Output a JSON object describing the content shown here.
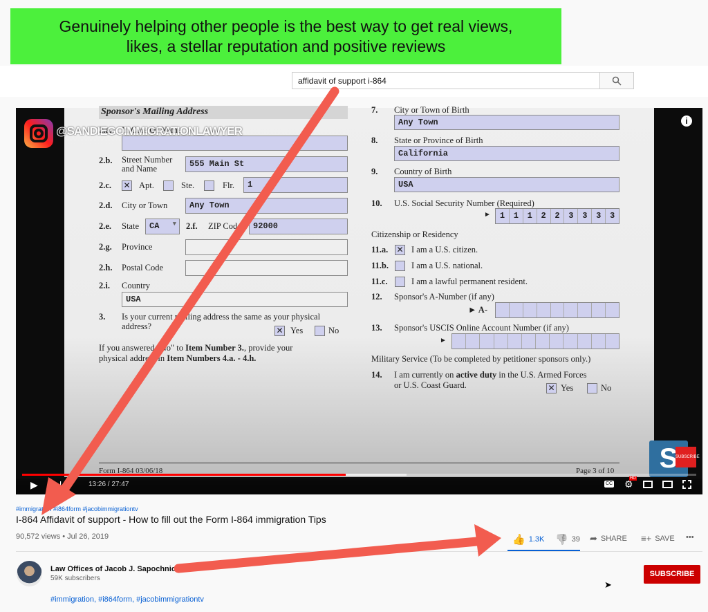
{
  "banner": {
    "line1": "Genuinely helping other people is the best way to get real views,",
    "line2": "likes, a stellar reputation and positive reviews",
    "color": "#4cf03c"
  },
  "search": {
    "value": "affidavit of support i-864",
    "icon": "search-icon"
  },
  "video": {
    "watermark": "@SANDIEGOIMMIGRATIONLAWYER",
    "time": "13:26 / 27:47",
    "progress": 0.48,
    "buffered": 0.57,
    "left": {
      "header": "Sponsor's Mailing Address",
      "a_num": "2.a.",
      "a_label": "In Care Of Name",
      "b_num": "2.b.",
      "b_label1": "Street Number",
      "b_label2": "and Name",
      "b_value": "555 Main St",
      "c_num": "2.c.",
      "c_apt": "Apt.",
      "c_ste": "Ste.",
      "c_flr": "Flr.",
      "c_value": "1",
      "c_mark": "✕",
      "d_num": "2.d.",
      "d_label": "City or Town",
      "d_value": "Any Town",
      "e_num": "2.e.",
      "e_label": "State",
      "e_value": "CA",
      "f_num": "2.f.",
      "f_label": "ZIP Code",
      "f_value": "92000",
      "g_num": "2.g.",
      "g_label": "Province",
      "h_num": "2.h.",
      "h_label": "Postal Code",
      "i_num": "2.i.",
      "i_label": "Country",
      "i_value": "USA",
      "q3_num": "3.",
      "q3_line1": "Is your current mailing address the same as your physical",
      "q3_line2": "address?",
      "yes": "Yes",
      "no": "No",
      "note_1a": "If you answered \"No\" to ",
      "note_1b": "Item Number 3.",
      ", ": "",
      "note_1c": ", provide your",
      "note_2a": "physical address in ",
      "note_2b": "Item Numbers 4.a. - 4.h."
    },
    "right": {
      "n7": "7.",
      "l7": "City or Town of Birth",
      "v7": "Any Town",
      "n8": "8.",
      "l8": "State or Province of Birth",
      "v8": "California",
      "n9": "9.",
      "l9": "Country of Birth",
      "v9": "USA",
      "n10": "10.",
      "l10": "U.S. Social Security Number (Required)",
      "ssn": [
        "1",
        "1",
        "1",
        "2",
        "2",
        "3",
        "3",
        "3",
        "3"
      ],
      "cit": "Citizenship or Residency",
      "n11a": "11.a.",
      "l11a": "I am a U.S. citizen.",
      "n11b": "11.b.",
      "l11b": "I am a U.S. national.",
      "n11c": "11.c.",
      "l11c": "I am a lawful permanent resident.",
      "n12": "12.",
      "l12": "Sponsor's A-Number (if any)",
      "a_prefix": "► A-",
      "n13": "13.",
      "l13": "Sponsor's USCIS Online Account Number (if any)",
      "arrow": "►",
      "mil": "Military Service (To be completed by petitioner sponsors only.)",
      "n14": "14.",
      "l14a": "I am currently on ",
      "l14b": "active duty",
      "l14c": " in the U.S. Armed Forces",
      "l14d": "or U.S. Coast Guard.",
      "yes": "Yes",
      "no": "No"
    },
    "footer_left": "Form I-864  03/06/18",
    "footer_right": "Page 3 of 10",
    "subscribe_badge": "SUBSCRIBE",
    "hd": "HD"
  },
  "info": {
    "tags_top": "#immigration #i864form #jacobimmigrationtv",
    "title": "I-864 Affidavit of support - How to fill out the Form I-864 immigration Tips",
    "meta": "90,572 views • Jul 26, 2019",
    "likes": "1.3K",
    "dislikes": "39",
    "share": "SHARE",
    "save": "SAVE",
    "more": "•••",
    "accent": "#065fd4"
  },
  "channel": {
    "name": "Law Offices of Jacob J. Sapochnick",
    "subs": "59K subscribers",
    "subscribe": "SUBSCRIBE",
    "tags": "#immigration, #i864form, #jacobimmigrationtv",
    "subscribe_color": "#cc0000"
  },
  "annotation_color": "#f25c4f"
}
